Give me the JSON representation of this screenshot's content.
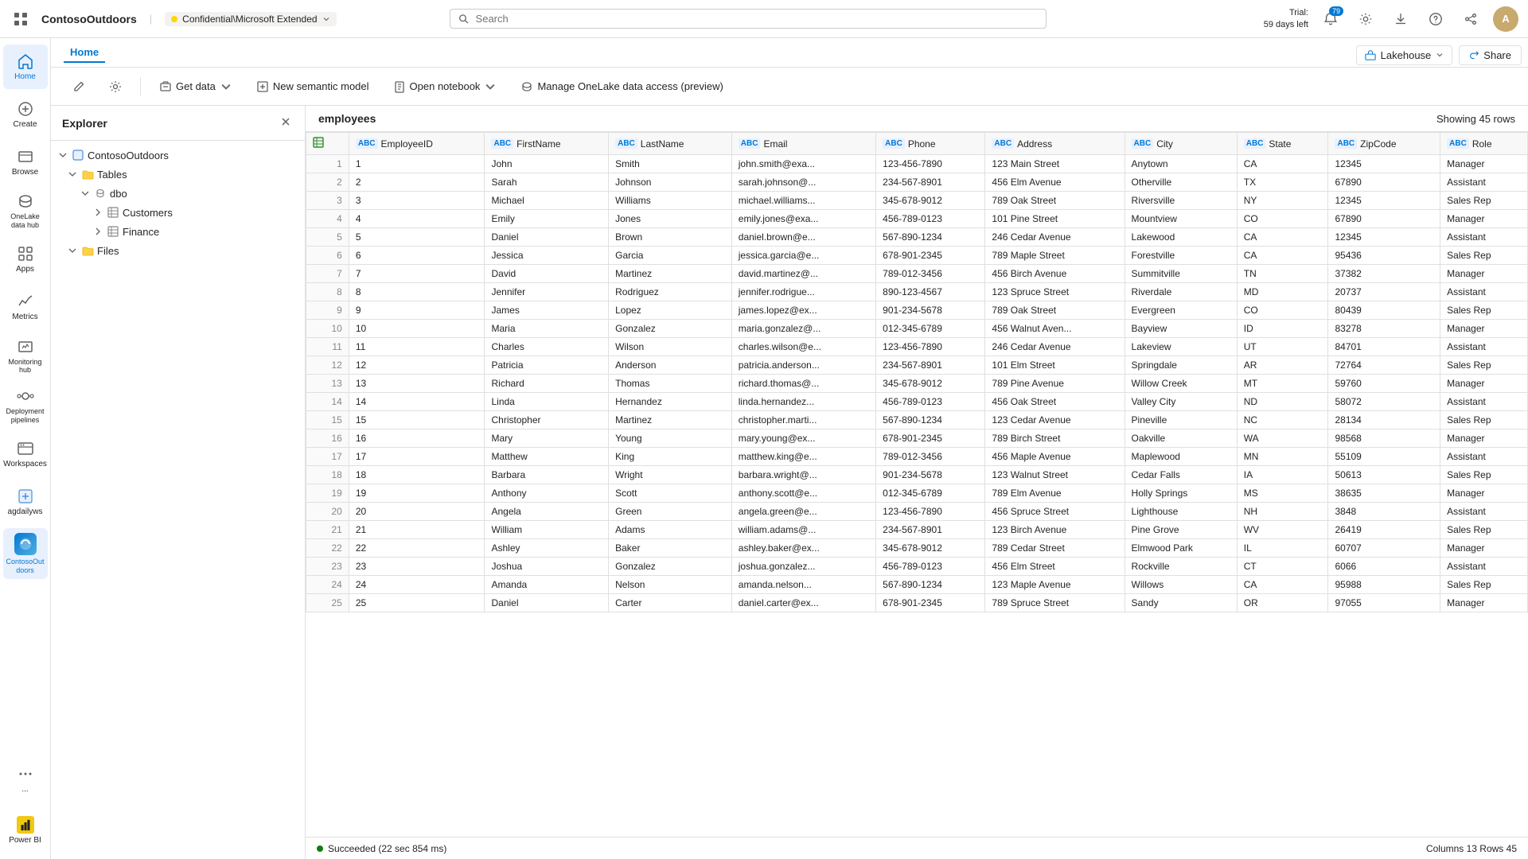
{
  "topbar": {
    "app_title": "ContosoOutdoors",
    "sensitivity_label": "Confidential\\Microsoft Extended",
    "search_placeholder": "Search",
    "trial_line1": "Trial:",
    "trial_line2": "59 days left",
    "notification_count": "79",
    "avatar_initials": "A"
  },
  "home_tab": {
    "label": "Home"
  },
  "toolbar": {
    "get_data_label": "Get data",
    "new_semantic_model_label": "New semantic model",
    "open_notebook_label": "Open notebook",
    "manage_onelake_label": "Manage OneLake data access (preview)"
  },
  "top_right": {
    "lakehouse_label": "Lakehouse",
    "share_label": "Share"
  },
  "explorer": {
    "title": "Explorer",
    "tree": {
      "workspace": "ContosoOutdoors",
      "tables_label": "Tables",
      "dbo_label": "dbo",
      "customers_label": "Customers",
      "finance_label": "Finance",
      "files_label": "Files"
    }
  },
  "data_panel": {
    "table_name": "employees",
    "row_count_label": "Showing 45 rows",
    "columns": [
      "EmployeeID",
      "FirstName",
      "LastName",
      "Email",
      "Phone",
      "Address",
      "City",
      "State",
      "ZipCode",
      "Role"
    ],
    "col_types": [
      "ABC",
      "ABC",
      "ABC",
      "ABC",
      "ABC",
      "ABC",
      "ABC",
      "ABC",
      "ABC",
      "ABC"
    ],
    "rows": [
      [
        1,
        1,
        "John",
        "Smith",
        "john.smith@exa...",
        "123-456-7890",
        "123 Main Street",
        "Anytown",
        "CA",
        "12345",
        "Manager"
      ],
      [
        2,
        2,
        "Sarah",
        "Johnson",
        "sarah.johnson@...",
        "234-567-8901",
        "456 Elm Avenue",
        "Otherville",
        "TX",
        "67890",
        "Assistant"
      ],
      [
        3,
        3,
        "Michael",
        "Williams",
        "michael.williams...",
        "345-678-9012",
        "789 Oak Street",
        "Riversville",
        "NY",
        "12345",
        "Sales Rep"
      ],
      [
        4,
        4,
        "Emily",
        "Jones",
        "emily.jones@exa...",
        "456-789-0123",
        "101 Pine Street",
        "Mountview",
        "CO",
        "67890",
        "Manager"
      ],
      [
        5,
        5,
        "Daniel",
        "Brown",
        "daniel.brown@e...",
        "567-890-1234",
        "246 Cedar Avenue",
        "Lakewood",
        "CA",
        "12345",
        "Assistant"
      ],
      [
        6,
        6,
        "Jessica",
        "Garcia",
        "jessica.garcia@e...",
        "678-901-2345",
        "789 Maple Street",
        "Forestville",
        "CA",
        "95436",
        "Sales Rep"
      ],
      [
        7,
        7,
        "David",
        "Martinez",
        "david.martinez@...",
        "789-012-3456",
        "456 Birch Avenue",
        "Summitville",
        "TN",
        "37382",
        "Manager"
      ],
      [
        8,
        8,
        "Jennifer",
        "Rodriguez",
        "jennifer.rodrigue...",
        "890-123-4567",
        "123 Spruce Street",
        "Riverdale",
        "MD",
        "20737",
        "Assistant"
      ],
      [
        9,
        9,
        "James",
        "Lopez",
        "james.lopez@ex...",
        "901-234-5678",
        "789 Oak Street",
        "Evergreen",
        "CO",
        "80439",
        "Sales Rep"
      ],
      [
        10,
        10,
        "Maria",
        "Gonzalez",
        "maria.gonzalez@...",
        "012-345-6789",
        "456 Walnut Aven...",
        "Bayview",
        "ID",
        "83278",
        "Manager"
      ],
      [
        11,
        11,
        "Charles",
        "Wilson",
        "charles.wilson@e...",
        "123-456-7890",
        "246 Cedar Avenue",
        "Lakeview",
        "UT",
        "84701",
        "Assistant"
      ],
      [
        12,
        12,
        "Patricia",
        "Anderson",
        "patricia.anderson...",
        "234-567-8901",
        "101 Elm Street",
        "Springdale",
        "AR",
        "72764",
        "Sales Rep"
      ],
      [
        13,
        13,
        "Richard",
        "Thomas",
        "richard.thomas@...",
        "345-678-9012",
        "789 Pine Avenue",
        "Willow Creek",
        "MT",
        "59760",
        "Manager"
      ],
      [
        14,
        14,
        "Linda",
        "Hernandez",
        "linda.hernandez...",
        "456-789-0123",
        "456 Oak Street",
        "Valley City",
        "ND",
        "58072",
        "Assistant"
      ],
      [
        15,
        15,
        "Christopher",
        "Martinez",
        "christopher.marti...",
        "567-890-1234",
        "123 Cedar Avenue",
        "Pineville",
        "NC",
        "28134",
        "Sales Rep"
      ],
      [
        16,
        16,
        "Mary",
        "Young",
        "mary.young@ex...",
        "678-901-2345",
        "789 Birch Street",
        "Oakville",
        "WA",
        "98568",
        "Manager"
      ],
      [
        17,
        17,
        "Matthew",
        "King",
        "matthew.king@e...",
        "789-012-3456",
        "456 Maple Avenue",
        "Maplewood",
        "MN",
        "55109",
        "Assistant"
      ],
      [
        18,
        18,
        "Barbara",
        "Wright",
        "barbara.wright@...",
        "901-234-5678",
        "123 Walnut Street",
        "Cedar Falls",
        "IA",
        "50613",
        "Sales Rep"
      ],
      [
        19,
        19,
        "Anthony",
        "Scott",
        "anthony.scott@e...",
        "012-345-6789",
        "789 Elm Avenue",
        "Holly Springs",
        "MS",
        "38635",
        "Manager"
      ],
      [
        20,
        20,
        "Angela",
        "Green",
        "angela.green@e...",
        "123-456-7890",
        "456 Spruce Street",
        "Lighthouse",
        "NH",
        "3848",
        "Assistant"
      ],
      [
        21,
        21,
        "William",
        "Adams",
        "william.adams@...",
        "234-567-8901",
        "123 Birch Avenue",
        "Pine Grove",
        "WV",
        "26419",
        "Sales Rep"
      ],
      [
        22,
        22,
        "Ashley",
        "Baker",
        "ashley.baker@ex...",
        "345-678-9012",
        "789 Cedar Street",
        "Elmwood Park",
        "IL",
        "60707",
        "Manager"
      ],
      [
        23,
        23,
        "Joshua",
        "Gonzalez",
        "joshua.gonzalez...",
        "456-789-0123",
        "456 Elm Street",
        "Rockville",
        "CT",
        "6066",
        "Assistant"
      ],
      [
        24,
        24,
        "Amanda",
        "Nelson",
        "amanda.nelson...",
        "567-890-1234",
        "123 Maple Avenue",
        "Willows",
        "CA",
        "95988",
        "Sales Rep"
      ],
      [
        25,
        25,
        "Daniel",
        "Carter",
        "daniel.carter@ex...",
        "678-901-2345",
        "789 Spruce Street",
        "Sandy",
        "OR",
        "97055",
        "Manager"
      ]
    ]
  },
  "status_bar": {
    "success_text": "Succeeded (22 sec 854 ms)",
    "columns_rows": "Columns 13 Rows 45"
  },
  "sidebar": {
    "items": [
      {
        "id": "home",
        "label": "Home"
      },
      {
        "id": "create",
        "label": "Create"
      },
      {
        "id": "browse",
        "label": "Browse"
      },
      {
        "id": "onelake",
        "label": "OneLake data hub"
      },
      {
        "id": "apps",
        "label": "Apps"
      },
      {
        "id": "metrics",
        "label": "Metrics"
      },
      {
        "id": "monitoring",
        "label": "Monitoring hub"
      },
      {
        "id": "deployment",
        "label": "Deployment pipelines"
      },
      {
        "id": "workspaces",
        "label": "Workspaces"
      },
      {
        "id": "agdailyws",
        "label": "agdailyws"
      },
      {
        "id": "contoso",
        "label": "ContosoOut doors"
      },
      {
        "id": "more",
        "label": "..."
      },
      {
        "id": "powerbi",
        "label": "Power BI"
      }
    ]
  }
}
